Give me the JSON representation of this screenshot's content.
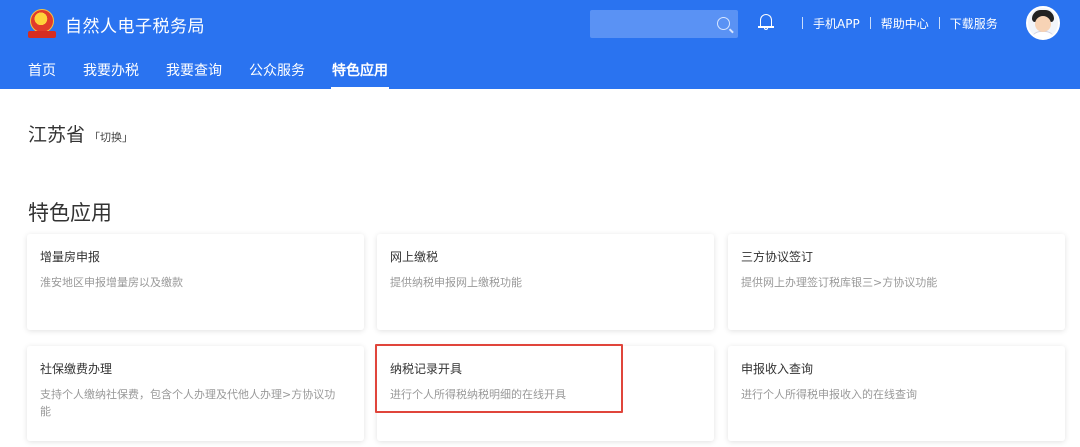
{
  "header": {
    "app_title": "自然人电子税务局",
    "search": {
      "value": "",
      "placeholder": ""
    },
    "links": [
      "手机APP",
      "帮助中心",
      "下载服务"
    ]
  },
  "nav": {
    "tabs": [
      {
        "label": "首页",
        "active": false
      },
      {
        "label": "我要办税",
        "active": false
      },
      {
        "label": "我要查询",
        "active": false
      },
      {
        "label": "公众服务",
        "active": false
      },
      {
        "label": "特色应用",
        "active": true
      }
    ]
  },
  "region": {
    "province": "江苏省",
    "switch_label": "「切换」"
  },
  "section": {
    "title": "特色应用"
  },
  "cards": [
    {
      "title": "增量房申报",
      "desc": "淮安地区申报增量房以及缴款"
    },
    {
      "title": "网上缴税",
      "desc": "提供纳税申报网上缴税功能"
    },
    {
      "title": "三方协议签订",
      "desc": "提供网上办理签订税库银三>方协议功能"
    },
    {
      "title": "社保缴费办理",
      "desc": "支持个人缴纳社保费，包含个人办理及代他人办理>方协议功能"
    },
    {
      "title": "纳税记录开具",
      "desc": "进行个人所得税纳税明细的在线开具"
    },
    {
      "title": "申报收入查询",
      "desc": "进行个人所得税申报收入的在线查询"
    }
  ],
  "colors": {
    "brand_blue": "#2a73f0",
    "highlight_red": "#e0453b"
  },
  "icons": [
    "tax-emblem-icon",
    "search-icon",
    "bell-icon",
    "avatar"
  ]
}
